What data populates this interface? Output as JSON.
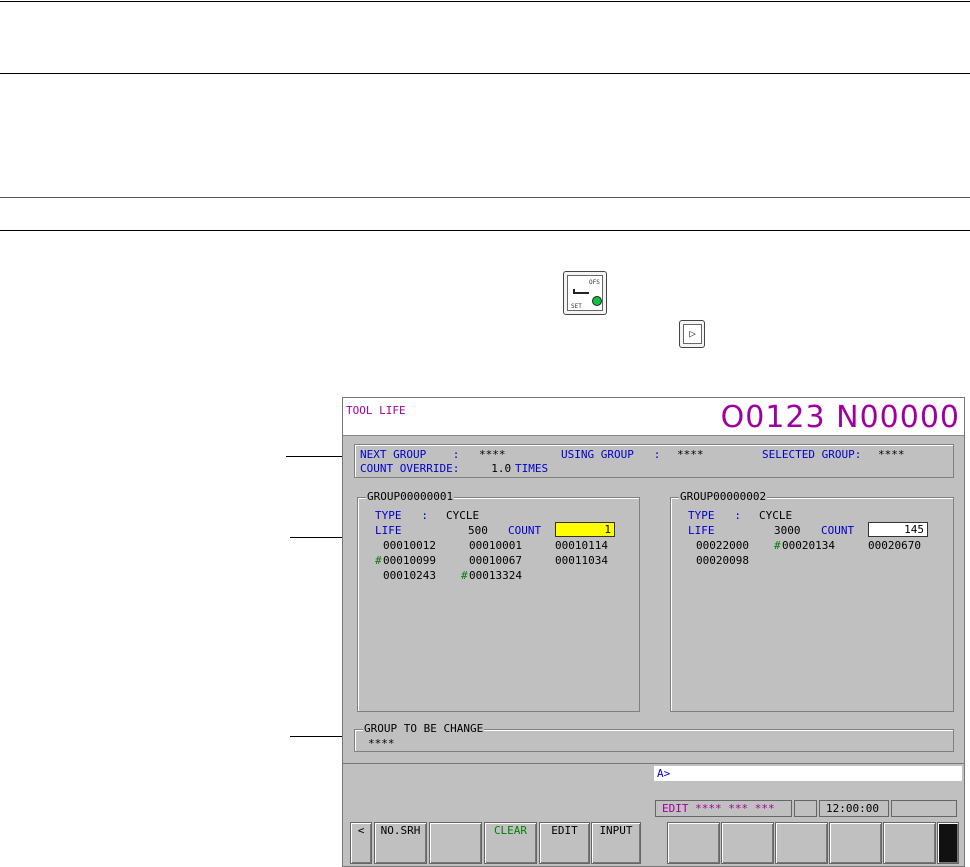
{
  "screen": {
    "title": "TOOL LIFE",
    "program_number": "O0123 N00000",
    "header": {
      "next_group_label": "NEXT GROUP    :",
      "next_group_value": "****",
      "using_group_label": "USING GROUP   :",
      "using_group_value": "****",
      "selected_group_label": "SELECTED GROUP:",
      "selected_group_value": "****",
      "count_override_label": "COUNT OVERRIDE:",
      "count_override_value": "  1.0",
      "count_override_unit": "TIMES"
    },
    "groups": [
      {
        "title": "GROUP00000001",
        "type_label": "TYPE   :",
        "type_value": "CYCLE",
        "life_label": "LIFE",
        "life_value": "500",
        "count_label": "COUNT",
        "count_value": "1",
        "tools": [
          {
            "hash": "",
            "num": "00010012"
          },
          {
            "hash": "",
            "num": "00010001"
          },
          {
            "hash": "",
            "num": "00010114"
          },
          {
            "hash": "#",
            "num": "00010099"
          },
          {
            "hash": "",
            "num": "00010067"
          },
          {
            "hash": "",
            "num": "00011034"
          },
          {
            "hash": "",
            "num": "00010243"
          },
          {
            "hash": "#",
            "num": "00013324"
          }
        ]
      },
      {
        "title": "GROUP00000002",
        "type_label": "TYPE   :",
        "type_value": "CYCLE",
        "life_label": "LIFE",
        "life_value": "3000",
        "count_label": "COUNT",
        "count_value": "145",
        "tools": [
          {
            "hash": "",
            "num": "00022000"
          },
          {
            "hash": "#",
            "num": "00020134"
          },
          {
            "hash": "",
            "num": "00020670"
          },
          {
            "hash": "",
            "num": "00020098"
          }
        ]
      }
    ],
    "change_panel": {
      "title": "GROUP TO BE CHANGE",
      "value": "****"
    },
    "input_prompt": "A>",
    "status": {
      "mode": "EDIT",
      "fields": "**** *** ***",
      "time": "12:00:00"
    },
    "softkeys": {
      "prev": "<",
      "no_srh": "NO.SRH",
      "blank1": "",
      "clear": "CLEAR",
      "edit": "EDIT",
      "input": "INPUT"
    },
    "colors": {
      "title": "#a000a0",
      "label": "#0000cc",
      "count_highlight": "#ffff00",
      "hash": "#008000",
      "clear_key": "#008000",
      "screen_bg": "#c0c0c0"
    }
  },
  "keys": {
    "offset_setting_key": {
      "label_top": "OFS",
      "label_bottom": "SET"
    },
    "next_soft_key": {
      "label": "▷"
    }
  }
}
